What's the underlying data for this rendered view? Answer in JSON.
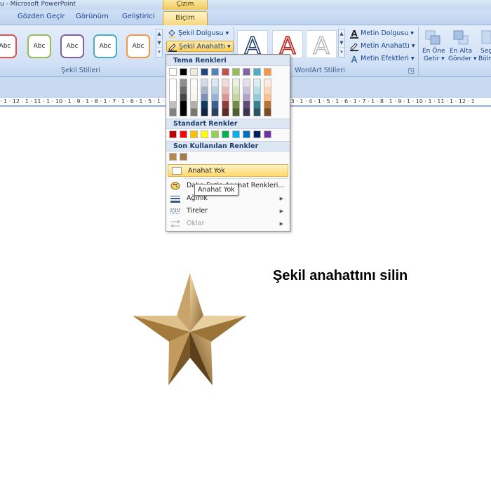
{
  "window": {
    "title": "u - Microsoft PowerPoint",
    "context_group": "Çizim Araçları"
  },
  "tabs": [
    {
      "label": "Gözden Geçir"
    },
    {
      "label": "Görünüm"
    },
    {
      "label": "Geliştirici"
    },
    {
      "label": "Biçim",
      "active": true
    }
  ],
  "ribbon": {
    "shape_styles": {
      "label": "Şekil Stilleri",
      "gallery": [
        {
          "text": "Abc",
          "border": "#d9534f"
        },
        {
          "text": "Abc",
          "border": "#9bbb59"
        },
        {
          "text": "Abc",
          "border": "#8064a2"
        },
        {
          "text": "Abc",
          "border": "#4bacc6"
        },
        {
          "text": "Abc",
          "border": "#f79646"
        }
      ],
      "fill_label": "Şekil Dolgusu",
      "outline_label": "Şekil Anahattı",
      "effects_icon": "shape-effects-icon"
    },
    "wordart": {
      "label": "WordArt Stilleri",
      "gallery": [
        "A",
        "A",
        "A"
      ],
      "text_fill": "Metin Dolgusu",
      "text_outline": "Metin Anahattı",
      "text_effects": "Metin Efektleri"
    },
    "arrange": {
      "bring_front_1": "En Öne",
      "bring_front_2": "Getir",
      "send_back_1": "En Alta",
      "send_back_2": "Gönder",
      "sel_1": "Seç",
      "sel_2": "Bölm"
    }
  },
  "ruler": {
    "text": "· 1 · 12 · 1 · 11 · 1 · 10 · 1 · 9 · 1 · 8 · 1 · 7 · 1 · 6 · 1 · 5 · 1 · 4 · 1 · 3 · 1 · 2 · 1 · 1 · 1 · 0 · 1 · 1 · 1 · 2 · 1 · 3 · 1 · 4 · 1 · 5 · 1 · 6 · 1 · 7 · 1 · 8 · 1 · 9 · 1 · 10 · 1 · 11 · 1 · 12 · 1"
  },
  "dropdown": {
    "theme_colors_header": "Tema Renkleri",
    "theme_colors": [
      "#ffffff",
      "#000000",
      "#eeece1",
      "#1f497d",
      "#4f81bd",
      "#c0504d",
      "#9bbb59",
      "#8064a2",
      "#4bacc6",
      "#f79646"
    ],
    "standard_header": "Standart Renkler",
    "standard_colors": [
      "#c00000",
      "#ff0000",
      "#ffc000",
      "#ffff00",
      "#92d050",
      "#00b050",
      "#00b0f0",
      "#0070c0",
      "#002060",
      "#7030a0"
    ],
    "recent_header": "Son Kullanılan Renkler",
    "recent_colors": [
      "#b9884c",
      "#a67c45"
    ],
    "items": {
      "no_outline": "Anahat Yok",
      "more_colors": "Daha Fazla Anahat Renkleri...",
      "weight": "Ağırlık",
      "dashes": "Tireler",
      "arrows": "Oklar"
    }
  },
  "tooltip": "Anahat Yok",
  "slide": {
    "text": "Şekil anahattını silin"
  }
}
